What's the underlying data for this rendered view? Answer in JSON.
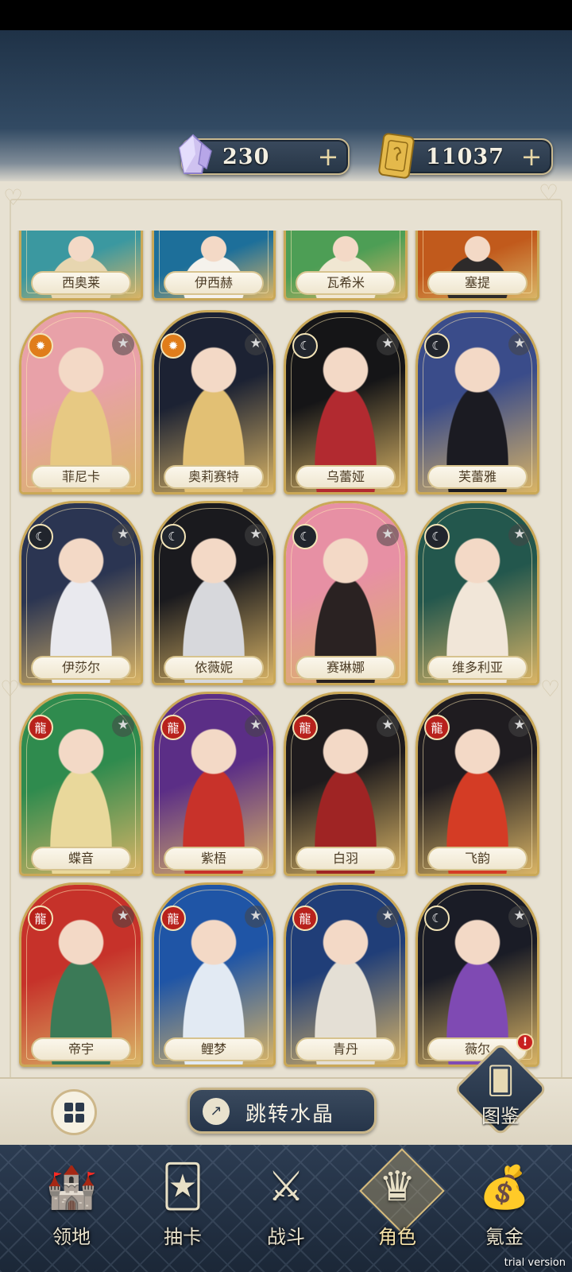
{
  "currencies": {
    "crystal": {
      "value": "230",
      "plus": "+",
      "icon": "crystal-icon"
    },
    "ticket": {
      "value": "11037",
      "plus": "+",
      "icon": "ticket-icon"
    }
  },
  "characters": [
    {
      "name": "西奥莱",
      "faction": "none",
      "partial": true,
      "colors": [
        "#3b98a0",
        "#e7d6b0"
      ]
    },
    {
      "name": "伊西赫",
      "faction": "none",
      "partial": true,
      "colors": [
        "#1d6f9a",
        "#f5f2ec"
      ]
    },
    {
      "name": "瓦希米",
      "faction": "none",
      "partial": true,
      "colors": [
        "#4d9e55",
        "#f0e7d2"
      ]
    },
    {
      "name": "塞提",
      "faction": "none",
      "partial": true,
      "colors": [
        "#c15a1c",
        "#2d2a2a"
      ]
    },
    {
      "name": "菲尼卡",
      "faction": "sun",
      "colors": [
        "#e8a1a8",
        "#e7c983"
      ]
    },
    {
      "name": "奥莉赛特",
      "faction": "sun",
      "colors": [
        "#1c2233",
        "#e2c074"
      ]
    },
    {
      "name": "乌蕾娅",
      "faction": "moon",
      "colors": [
        "#151517",
        "#b22a30"
      ]
    },
    {
      "name": "芙蕾雅",
      "faction": "moon",
      "colors": [
        "#3a4c8a",
        "#1b1b22"
      ]
    },
    {
      "name": "伊莎尔",
      "faction": "moon",
      "colors": [
        "#2b3552",
        "#e9e9ee"
      ]
    },
    {
      "name": "依薇妮",
      "faction": "moon",
      "colors": [
        "#1a1a1e",
        "#d7d8dc"
      ]
    },
    {
      "name": "赛琳娜",
      "faction": "moon",
      "colors": [
        "#e790a4",
        "#2a2222"
      ]
    },
    {
      "name": "维多利亚",
      "faction": "moon",
      "colors": [
        "#23574d",
        "#f1e6d8"
      ]
    },
    {
      "name": "蝶音",
      "faction": "dragon",
      "colors": [
        "#2f8b4e",
        "#e9d89b"
      ]
    },
    {
      "name": "紫梧",
      "faction": "dragon",
      "colors": [
        "#5b2e86",
        "#c8322a"
      ]
    },
    {
      "name": "白羽",
      "faction": "dragon",
      "colors": [
        "#1e1b1d",
        "#9f2424"
      ]
    },
    {
      "name": "飞韵",
      "faction": "dragon",
      "colors": [
        "#1f1c20",
        "#d43c25"
      ]
    },
    {
      "name": "帝宇",
      "faction": "dragon",
      "colors": [
        "#c6322a",
        "#3b7a57"
      ]
    },
    {
      "name": "鲤梦",
      "faction": "dragon",
      "colors": [
        "#1f55a6",
        "#e2eaf3"
      ]
    },
    {
      "name": "青丹",
      "faction": "dragon",
      "colors": [
        "#203e78",
        "#e4dfd5"
      ]
    },
    {
      "name": "薇尔",
      "faction": "moon",
      "colors": [
        "#1a1c26",
        "#7f4ab3"
      ]
    }
  ],
  "toolbar": {
    "jump_label": "跳转水晶",
    "codex_label": "图鉴",
    "alert": "!"
  },
  "nav": [
    {
      "label": "领地",
      "icon": "castle-icon",
      "active": false
    },
    {
      "label": "抽卡",
      "icon": "cards-icon",
      "active": false
    },
    {
      "label": "战斗",
      "icon": "crossed-swords-icon",
      "active": false
    },
    {
      "label": "角色",
      "icon": "character-icon",
      "active": true
    },
    {
      "label": "氪金",
      "icon": "treasure-chest-icon",
      "active": false
    }
  ],
  "watermark": "trial version"
}
